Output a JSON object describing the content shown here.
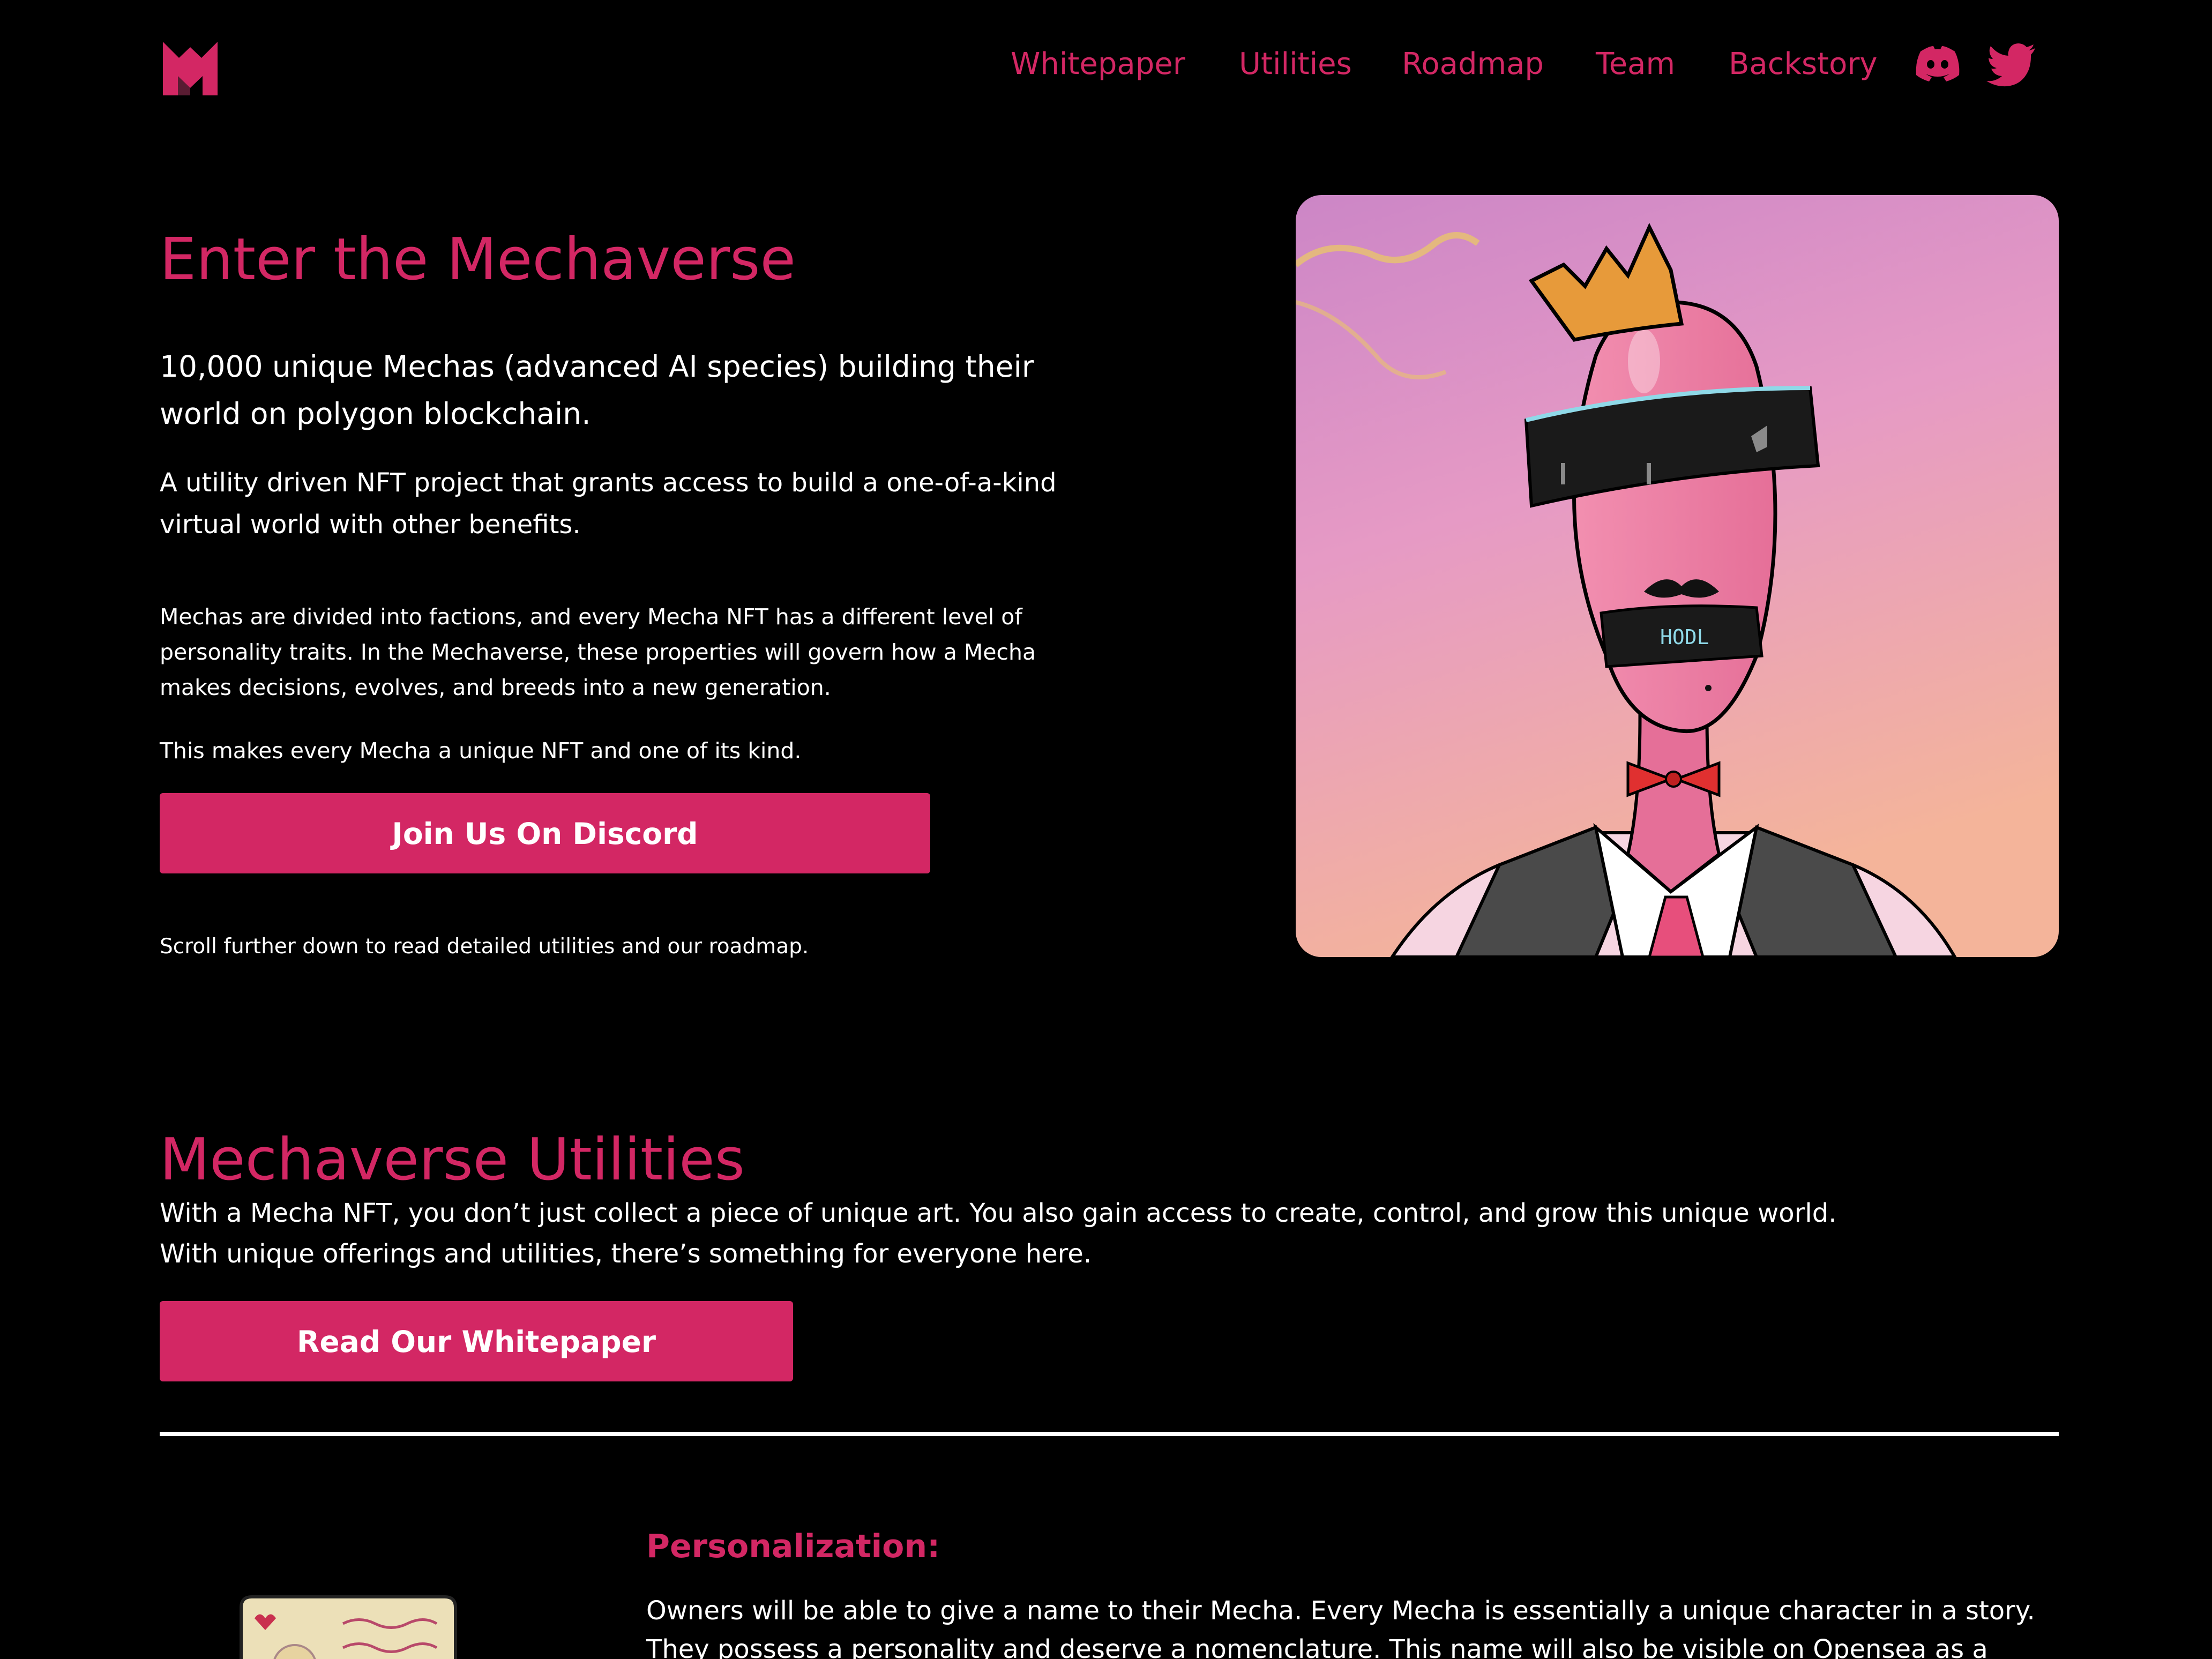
{
  "brand": {
    "accent": "#d32764",
    "logo_icon": "m-logo-icon"
  },
  "nav": {
    "links": [
      {
        "label": "Whitepaper"
      },
      {
        "label": "Utilities"
      },
      {
        "label": "Roadmap"
      },
      {
        "label": "Team"
      },
      {
        "label": "Backstory"
      }
    ],
    "icons": [
      "discord-icon",
      "twitter-icon"
    ]
  },
  "hero": {
    "title": "Enter the Mechaverse",
    "lead": "10,000 unique Mechas (advanced AI species) building their world on polygon blockchain.",
    "sub": "A utility driven NFT project that grants access to build a one-of-a-kind virtual world with other benefits.",
    "para1": "Mechas are divided into factions, and every Mecha NFT has a different level of personality traits. In the Mechaverse, these properties will govern how a Mecha makes decisions, evolves, and breeds into a new generation.",
    "para2": "This makes every Mecha a unique NFT and one of its kind.",
    "cta_label": "Join Us On Discord",
    "scroll_note": "Scroll further down to read detailed utilities and our roadmap.",
    "art_visor_text": "HODL"
  },
  "utilities": {
    "title": "Mechaverse Utilities",
    "desc_line1": "With a Mecha NFT, you don’t just collect a piece of unique art. You also gain access to create, control, and grow this unique world.",
    "desc_line2": "With unique offerings and utilities, there’s something for everyone here.",
    "cta_label": "Read Our Whitepaper"
  },
  "feature": {
    "title": "Personalization:",
    "text": "Owners will be able to give a name to their Mecha. Every Mecha is essentially a unique character in a story. They possess a personality and deserve a nomenclature. This name will also be visible on Opensea as a"
  }
}
